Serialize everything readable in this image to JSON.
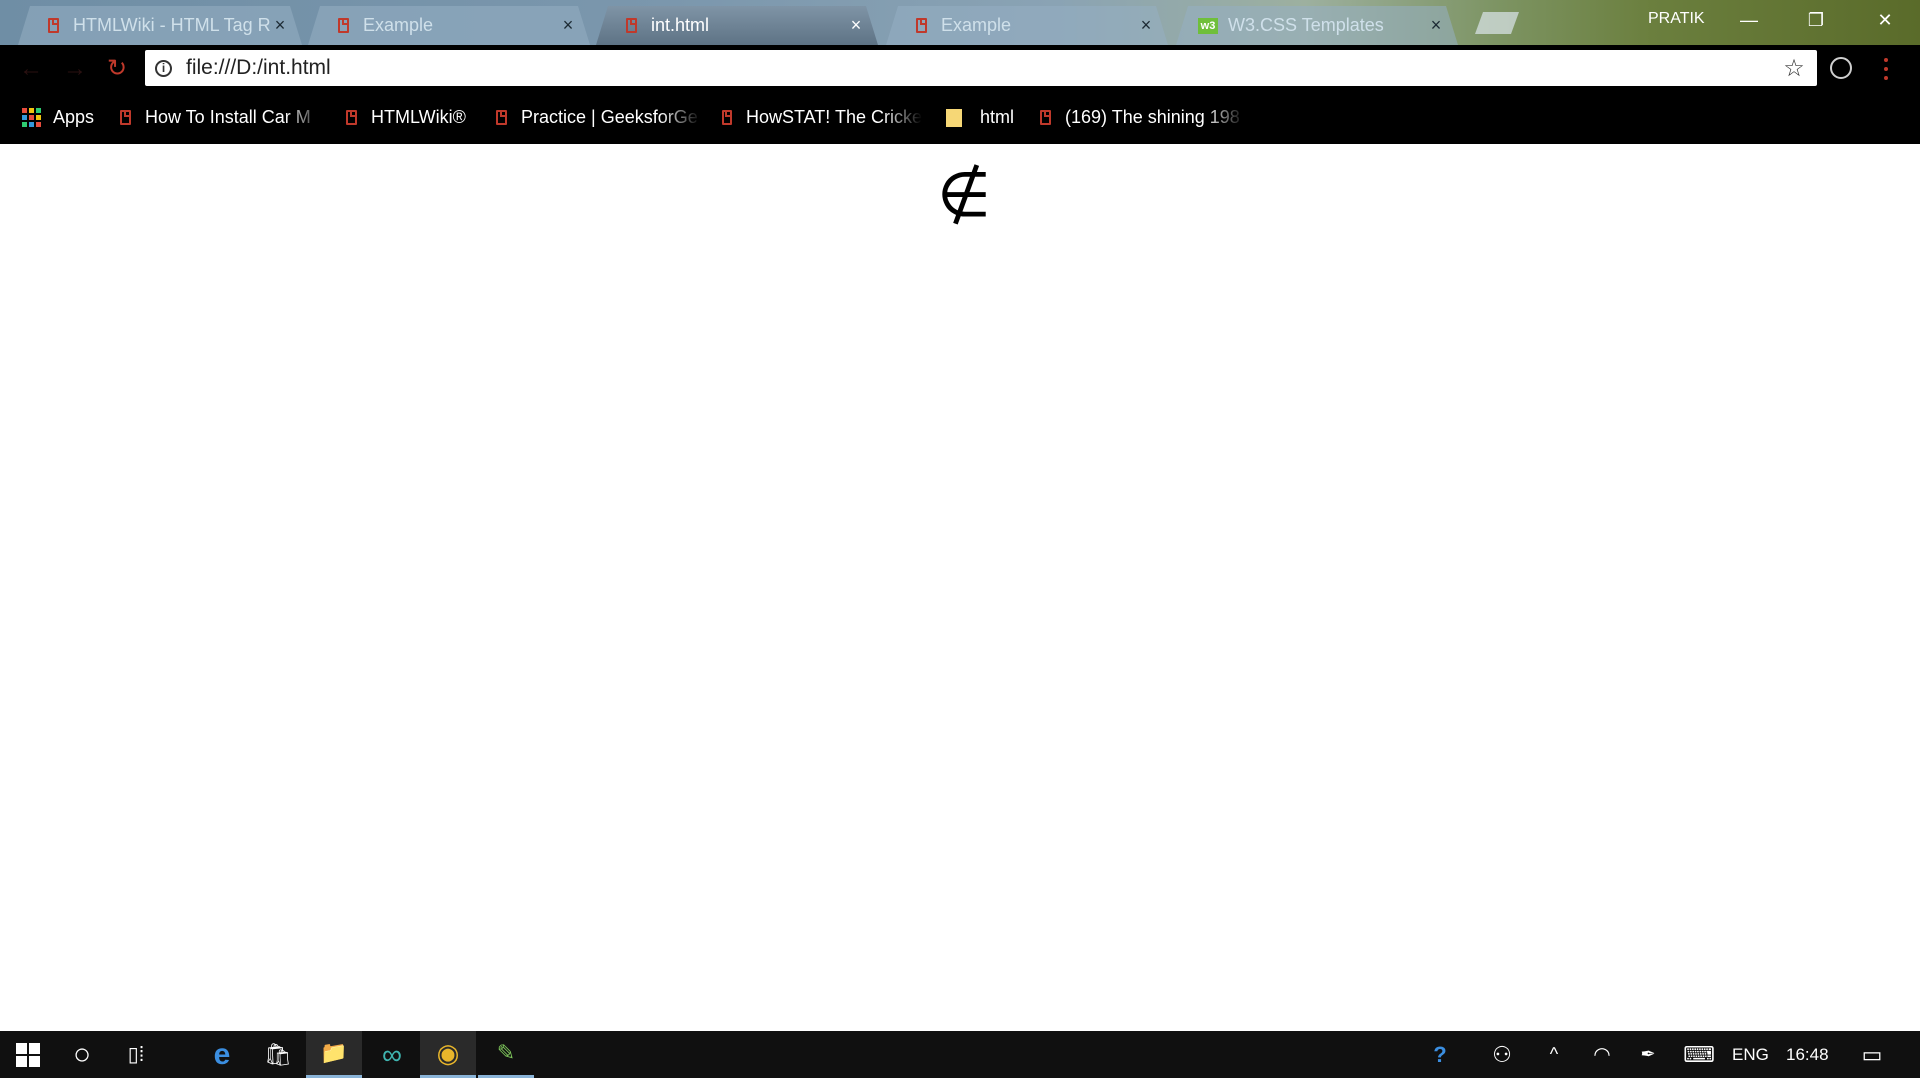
{
  "tabs": [
    {
      "title": "HTMLWiki - HTML Tag Re",
      "active": false,
      "icon": "page-icon"
    },
    {
      "title": "Example",
      "active": false,
      "icon": "page-icon"
    },
    {
      "title": "int.html",
      "active": true,
      "icon": "page-icon"
    },
    {
      "title": "Example",
      "active": false,
      "icon": "page-icon"
    },
    {
      "title": "W3.CSS Templates",
      "active": false,
      "icon": "w3-icon"
    }
  ],
  "tab_close_glyph": "×",
  "w3_badge": "w3",
  "profile_name": "PRATIK",
  "window_controls": {
    "minimize": "—",
    "restore": "❐",
    "close": "✕"
  },
  "toolbar": {
    "back_glyph": "←",
    "forward_glyph": "→",
    "reload_glyph": "↻",
    "info_glyph": "i",
    "url": "file:///D:/int.html",
    "star_glyph": "☆"
  },
  "bookmarks": [
    {
      "label": "Apps",
      "icon": "apps-icon"
    },
    {
      "label": "How To Install Car M",
      "icon": "page-icon"
    },
    {
      "label": "HTMLWiki®",
      "icon": "page-icon"
    },
    {
      "label": "Practice | GeeksforGe",
      "icon": "page-icon"
    },
    {
      "label": "HowSTAT! The Cricke",
      "icon": "page-icon"
    },
    {
      "label": "html",
      "icon": "folder-icon"
    },
    {
      "label": "(169) The shining 198",
      "icon": "page-icon"
    }
  ],
  "content": {
    "symbol": "∉"
  },
  "taskbar": {
    "search_glyph": "○",
    "task_view_glyph": "▯⁞",
    "edge_glyph": "e",
    "store_glyph": "🛍",
    "explorer_glyph": "📁",
    "arduino_glyph": "∞",
    "chrome_glyph": "◉",
    "notepad_glyph": "✎",
    "help_glyph": "?",
    "people_glyph": "⚇",
    "chevron_glyph": "^",
    "wifi_glyph": "◠",
    "pen_glyph": "✒",
    "keyboard_glyph": "⌨",
    "language": "ENG",
    "time": "16:48",
    "notification_glyph": "▭"
  },
  "colors": {
    "accent_red": "#c0392b",
    "taskbar_bg": "#101010",
    "toolbar_bg": "#000000"
  }
}
